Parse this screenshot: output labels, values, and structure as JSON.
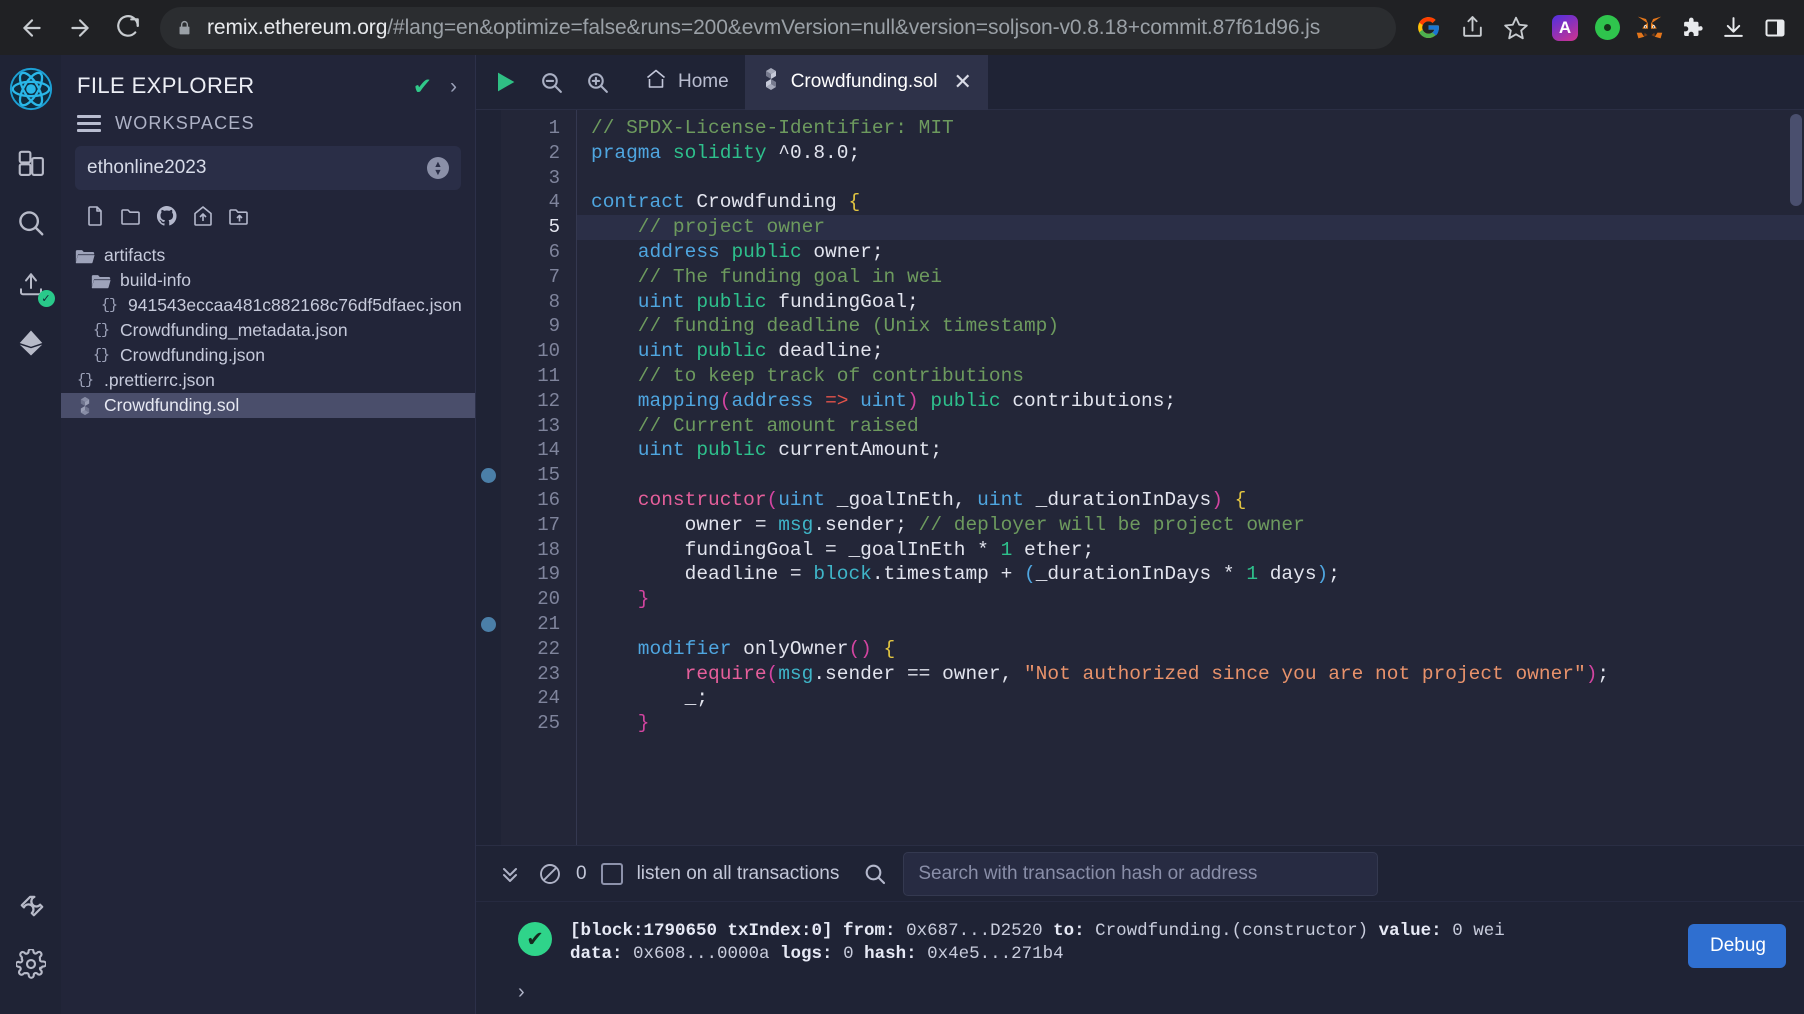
{
  "browser": {
    "back_label": "back-arrow",
    "forward_label": "forward-arrow",
    "reload_label": "reload",
    "url_domain": "remix.ethereum.org",
    "url_path": "/#lang=en&optimize=false&runs=200&evmVersion=null&version=soljson-v0.8.18+commit.87f61d96.js",
    "lock_icon": "lock-icon",
    "omnibox_icons": [
      "google-icon",
      "share-icon",
      "bookmark-star-icon"
    ],
    "extensions": [
      {
        "name": "arc-extension-icon",
        "glyph": "A",
        "color": "#4b36e8"
      },
      {
        "name": "green-dot-extension-icon",
        "glyph": "●",
        "color": "#2fc44d"
      },
      {
        "name": "metamask-fox-icon",
        "glyph": "🦊",
        "color": "#f6851b"
      },
      {
        "name": "extensions-puzzle-icon",
        "glyph": "❖",
        "color": "#e8eaed"
      },
      {
        "name": "downloads-icon",
        "glyph": "⤓",
        "color": "#e8eaed"
      },
      {
        "name": "side-panel-icon",
        "glyph": "◱",
        "color": "#e8eaed"
      }
    ]
  },
  "rail": {
    "items": [
      {
        "name": "remix-logo-icon",
        "label": "Remix"
      },
      {
        "name": "plugin-manager-icon",
        "label": "Plugin manager"
      },
      {
        "name": "search-icon",
        "label": "Search in files"
      },
      {
        "name": "solidity-compiler-icon",
        "label": "Solidity compiler"
      },
      {
        "name": "deploy-run-icon",
        "label": "Deploy & run transactions"
      },
      {
        "name": "plugin-wrench-icon",
        "label": "Plugin manager"
      },
      {
        "name": "settings-gear-icon",
        "label": "Settings"
      }
    ]
  },
  "file_explorer": {
    "title": "FILE EXPLORER",
    "check_icon": "✔",
    "chevron_icon": "›",
    "workspaces_label": "WORKSPACES",
    "workspace_value": "ethonline2023",
    "actions": [
      {
        "name": "create-new-file-icon",
        "label": "Create new file"
      },
      {
        "name": "create-new-folder-icon",
        "label": "Create new folder"
      },
      {
        "name": "github-clone-icon",
        "label": "Clone from GitHub"
      },
      {
        "name": "publish-to-gist-icon",
        "label": "Publish to gist"
      },
      {
        "name": "upload-folder-icon",
        "label": "Upload folder"
      }
    ],
    "files": [
      {
        "name": "artifacts",
        "type": "folder",
        "indent": 0,
        "selected": false
      },
      {
        "name": "build-info",
        "type": "folder",
        "indent": 1,
        "selected": false
      },
      {
        "name": "941543eccaa481c882168c76df5dfaec.json",
        "type": "json",
        "indent": 2,
        "selected": false
      },
      {
        "name": "Crowdfunding_metadata.json",
        "type": "json",
        "indent": 1,
        "selected": false
      },
      {
        "name": "Crowdfunding.json",
        "type": "json",
        "indent": 1,
        "selected": false
      },
      {
        "name": ".prettierrc.json",
        "type": "json",
        "indent": 0,
        "selected": false
      },
      {
        "name": "Crowdfunding.sol",
        "type": "sol",
        "indent": 0,
        "selected": true
      }
    ]
  },
  "editor": {
    "toolbar": [
      {
        "name": "run-script-icon",
        "label": "Run"
      },
      {
        "name": "zoom-out-icon",
        "label": "Zoom out"
      },
      {
        "name": "zoom-in-icon",
        "label": "Zoom in"
      }
    ],
    "tabs": [
      {
        "name": "tab-home",
        "label": "Home",
        "icon": "home-icon",
        "active": false,
        "closable": false
      },
      {
        "name": "tab-crowdfunding-sol",
        "label": "Crowdfunding.sol",
        "icon": "solidity-icon",
        "active": true,
        "closable": true
      }
    ],
    "close_glyph": "✕",
    "highlighted_line": 5,
    "breakpoint_lines": [
      15,
      21
    ],
    "lines": [
      {
        "n": 1,
        "tokens": [
          {
            "t": "// SPDX-License-Identifier: MIT",
            "c": "t-com"
          }
        ]
      },
      {
        "n": 2,
        "tokens": [
          {
            "t": "pragma ",
            "c": "t-key"
          },
          {
            "t": "solidity ",
            "c": "t-mod"
          },
          {
            "t": "^0.8.0;",
            "c": "t-var"
          }
        ]
      },
      {
        "n": 3,
        "tokens": []
      },
      {
        "n": 4,
        "tokens": [
          {
            "t": "contract ",
            "c": "t-key"
          },
          {
            "t": "Crowdfunding ",
            "c": "t-var"
          },
          {
            "t": "{",
            "c": "t-brc"
          }
        ]
      },
      {
        "n": 5,
        "tokens": [
          {
            "t": "    // project owner",
            "c": "t-com"
          }
        ]
      },
      {
        "n": 6,
        "tokens": [
          {
            "t": "    address ",
            "c": "t-type"
          },
          {
            "t": "public ",
            "c": "t-mod"
          },
          {
            "t": "owner;",
            "c": "t-var"
          }
        ]
      },
      {
        "n": 7,
        "tokens": [
          {
            "t": "    // The funding goal in wei",
            "c": "t-com"
          }
        ]
      },
      {
        "n": 8,
        "tokens": [
          {
            "t": "    uint ",
            "c": "t-type"
          },
          {
            "t": "public ",
            "c": "t-mod"
          },
          {
            "t": "fundingGoal;",
            "c": "t-var"
          }
        ]
      },
      {
        "n": 9,
        "tokens": [
          {
            "t": "    // funding deadline (Unix timestamp)",
            "c": "t-com"
          }
        ]
      },
      {
        "n": 10,
        "tokens": [
          {
            "t": "    uint ",
            "c": "t-type"
          },
          {
            "t": "public ",
            "c": "t-mod"
          },
          {
            "t": "deadline;",
            "c": "t-var"
          }
        ]
      },
      {
        "n": 11,
        "tokens": [
          {
            "t": "    // to keep track of contributions",
            "c": "t-com"
          }
        ]
      },
      {
        "n": 12,
        "tokens": [
          {
            "t": "    mapping",
            "c": "t-type"
          },
          {
            "t": "(",
            "c": "t-par"
          },
          {
            "t": "address ",
            "c": "t-type"
          },
          {
            "t": "=>",
            "c": "t-arr"
          },
          {
            "t": " uint",
            "c": "t-type"
          },
          {
            "t": ")",
            "c": "t-par"
          },
          {
            "t": " public ",
            "c": "t-mod"
          },
          {
            "t": "contributions;",
            "c": "t-var"
          }
        ]
      },
      {
        "n": 13,
        "tokens": [
          {
            "t": "    // Current amount raised",
            "c": "t-com"
          }
        ]
      },
      {
        "n": 14,
        "tokens": [
          {
            "t": "    uint ",
            "c": "t-type"
          },
          {
            "t": "public ",
            "c": "t-mod"
          },
          {
            "t": "currentAmount;",
            "c": "t-var"
          }
        ]
      },
      {
        "n": 15,
        "tokens": []
      },
      {
        "n": 16,
        "tokens": [
          {
            "t": "    constructor",
            "c": "t-fn"
          },
          {
            "t": "(",
            "c": "t-par"
          },
          {
            "t": "uint",
            "c": "t-type"
          },
          {
            "t": " _goalInEth, ",
            "c": "t-var"
          },
          {
            "t": "uint",
            "c": "t-type"
          },
          {
            "t": " _durationInDays",
            "c": "t-var"
          },
          {
            "t": ")",
            "c": "t-par"
          },
          {
            "t": " {",
            "c": "t-brc"
          }
        ]
      },
      {
        "n": 17,
        "tokens": [
          {
            "t": "        owner = ",
            "c": "t-var"
          },
          {
            "t": "msg",
            "c": "t-obj"
          },
          {
            "t": ".sender; ",
            "c": "t-var"
          },
          {
            "t": "// deployer will be project owner",
            "c": "t-com"
          }
        ]
      },
      {
        "n": 18,
        "tokens": [
          {
            "t": "        fundingGoal = _goalInEth * ",
            "c": "t-var"
          },
          {
            "t": "1",
            "c": "t-num"
          },
          {
            "t": " ether;",
            "c": "t-var"
          }
        ]
      },
      {
        "n": 19,
        "tokens": [
          {
            "t": "        deadline = ",
            "c": "t-var"
          },
          {
            "t": "block",
            "c": "t-obj"
          },
          {
            "t": ".timestamp + ",
            "c": "t-var"
          },
          {
            "t": "(",
            "c": "t-key"
          },
          {
            "t": "_durationInDays * ",
            "c": "t-var"
          },
          {
            "t": "1",
            "c": "t-num"
          },
          {
            "t": " days",
            "c": "t-var"
          },
          {
            "t": ")",
            "c": "t-key"
          },
          {
            "t": ";",
            "c": "t-var"
          }
        ]
      },
      {
        "n": 20,
        "tokens": [
          {
            "t": "    }",
            "c": "t-par"
          }
        ]
      },
      {
        "n": 21,
        "tokens": []
      },
      {
        "n": 22,
        "tokens": [
          {
            "t": "    modifier ",
            "c": "t-key"
          },
          {
            "t": "onlyOwner",
            "c": "t-var"
          },
          {
            "t": "()",
            "c": "t-par"
          },
          {
            "t": " {",
            "c": "t-brc"
          }
        ]
      },
      {
        "n": 23,
        "tokens": [
          {
            "t": "        require",
            "c": "t-fn"
          },
          {
            "t": "(",
            "c": "t-par"
          },
          {
            "t": "msg",
            "c": "t-obj"
          },
          {
            "t": ".sender == owner, ",
            "c": "t-var"
          },
          {
            "t": "\"Not authorized since you are not project owner\"",
            "c": "t-str"
          },
          {
            "t": ")",
            "c": "t-par"
          },
          {
            "t": ";",
            "c": "t-var"
          }
        ]
      },
      {
        "n": 24,
        "tokens": [
          {
            "t": "        _;",
            "c": "t-var"
          }
        ]
      },
      {
        "n": 25,
        "tokens": [
          {
            "t": "    }",
            "c": "t-par"
          }
        ]
      }
    ]
  },
  "terminal": {
    "collapse_icon": "»",
    "clear_icon": "⊘",
    "count": "0",
    "listen_label": "listen on all transactions",
    "search_icon": "search-icon",
    "search_placeholder": "Search with transaction hash or address",
    "search_value": "",
    "log": {
      "status_icon": "✔",
      "line1": "[block:1790650 txIndex:0] from: 0x687...D2520 to: Crowdfunding.(constructor) value: 0 wei",
      "line2": "data: 0x608...0000a logs: 0 hash: 0x4e5...271b4",
      "line1_parts": [
        {
          "t": "[block:1790650 txIndex:0]",
          "b": true
        },
        {
          "t": "  from:",
          "b": true
        },
        {
          "t": " 0x687...D2520 ",
          "b": false
        },
        {
          "t": "to:",
          "b": true
        },
        {
          "t": " Crowdfunding.(constructor) ",
          "b": false
        },
        {
          "t": "value:",
          "b": true
        },
        {
          "t": " 0 wei",
          "b": false
        }
      ],
      "line2_parts": [
        {
          "t": "data:",
          "b": true
        },
        {
          "t": " 0x608...0000a ",
          "b": false
        },
        {
          "t": "logs:",
          "b": true
        },
        {
          "t": " 0 ",
          "b": false
        },
        {
          "t": "hash:",
          "b": true
        },
        {
          "t": " 0x4e5...271b4",
          "b": false
        }
      ]
    },
    "debug_label": "Debug",
    "prompt_glyph": "›"
  },
  "colors": {
    "accent_green": "#2fd48a",
    "debug_blue": "#2f6fd0",
    "bg_dark": "#1f2335",
    "bg_panel": "#222539",
    "selection": "#4a4e6b"
  }
}
